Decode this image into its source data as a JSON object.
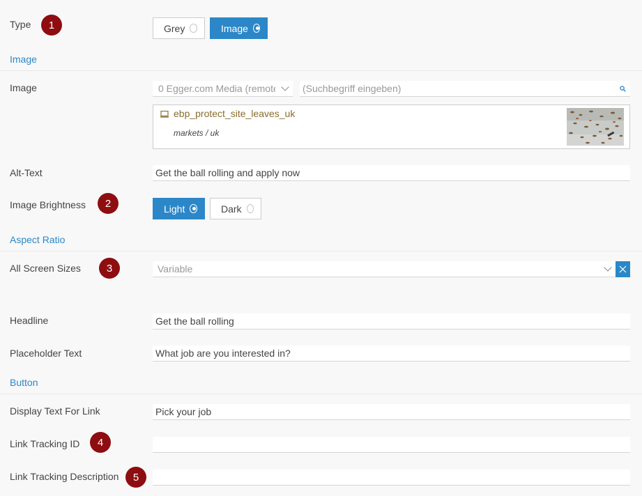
{
  "type_row": {
    "label": "Type",
    "badge": "1",
    "options": [
      {
        "label": "Grey",
        "selected": false
      },
      {
        "label": "Image",
        "selected": true
      }
    ]
  },
  "image_section": {
    "title": "Image",
    "image_row": {
      "label": "Image",
      "source_select": "0 Egger.com Media (remote",
      "search_placeholder": "(Suchbegriff eingeben)",
      "search_icon": "search-icon",
      "asset": {
        "name": "ebp_protect_site_leaves_uk",
        "path": "markets / uk",
        "icon": "monitor-icon"
      }
    },
    "alt_text": {
      "label": "Alt-Text",
      "value": "Get the ball rolling and apply now"
    },
    "brightness": {
      "label": "Image Brightness",
      "badge": "2",
      "options": [
        {
          "label": "Light",
          "selected": true
        },
        {
          "label": "Dark",
          "selected": false
        }
      ]
    }
  },
  "aspect_section": {
    "title": "Aspect Ratio",
    "screen_sizes": {
      "label": "All Screen Sizes",
      "badge": "3",
      "value": "Variable",
      "clear_icon": "close-icon"
    },
    "headline": {
      "label": "Headline",
      "value": "Get the ball rolling"
    },
    "placeholder_text": {
      "label": "Placeholder Text",
      "value": "What job are you interested in?"
    }
  },
  "button_section": {
    "title": "Button",
    "display_text": {
      "label": "Display Text For Link",
      "value": "Pick your job"
    },
    "tracking_id": {
      "label": "Link Tracking ID",
      "badge": "4",
      "value": ""
    },
    "tracking_description": {
      "label": "Link Tracking Description",
      "badge": "5",
      "value": ""
    }
  },
  "colors": {
    "accent": "#2b87c7",
    "badge": "#8e0d10",
    "asset_link": "#8a6d2e"
  }
}
